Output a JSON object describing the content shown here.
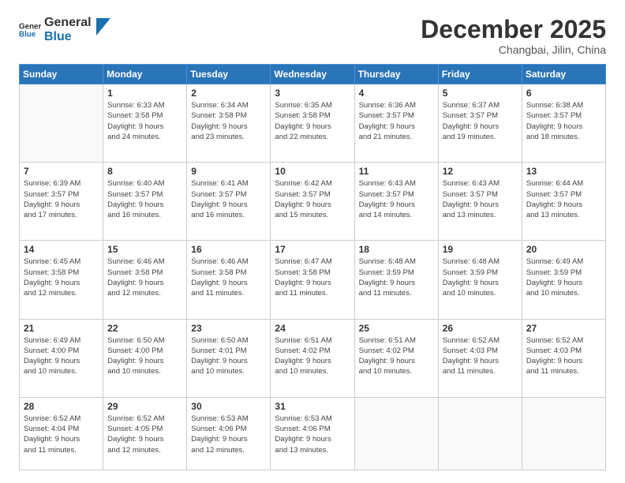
{
  "logo": {
    "text_general": "General",
    "text_blue": "Blue"
  },
  "header": {
    "month_title": "December 2025",
    "location": "Changbai, Jilin, China"
  },
  "days_of_week": [
    "Sunday",
    "Monday",
    "Tuesday",
    "Wednesday",
    "Thursday",
    "Friday",
    "Saturday"
  ],
  "weeks": [
    [
      {
        "day": "",
        "info": ""
      },
      {
        "day": "1",
        "info": "Sunrise: 6:33 AM\nSunset: 3:58 PM\nDaylight: 9 hours\nand 24 minutes."
      },
      {
        "day": "2",
        "info": "Sunrise: 6:34 AM\nSunset: 3:58 PM\nDaylight: 9 hours\nand 23 minutes."
      },
      {
        "day": "3",
        "info": "Sunrise: 6:35 AM\nSunset: 3:58 PM\nDaylight: 9 hours\nand 22 minutes."
      },
      {
        "day": "4",
        "info": "Sunrise: 6:36 AM\nSunset: 3:57 PM\nDaylight: 9 hours\nand 21 minutes."
      },
      {
        "day": "5",
        "info": "Sunrise: 6:37 AM\nSunset: 3:57 PM\nDaylight: 9 hours\nand 19 minutes."
      },
      {
        "day": "6",
        "info": "Sunrise: 6:38 AM\nSunset: 3:57 PM\nDaylight: 9 hours\nand 18 minutes."
      }
    ],
    [
      {
        "day": "7",
        "info": "Sunrise: 6:39 AM\nSunset: 3:57 PM\nDaylight: 9 hours\nand 17 minutes."
      },
      {
        "day": "8",
        "info": "Sunrise: 6:40 AM\nSunset: 3:57 PM\nDaylight: 9 hours\nand 16 minutes."
      },
      {
        "day": "9",
        "info": "Sunrise: 6:41 AM\nSunset: 3:57 PM\nDaylight: 9 hours\nand 16 minutes."
      },
      {
        "day": "10",
        "info": "Sunrise: 6:42 AM\nSunset: 3:57 PM\nDaylight: 9 hours\nand 15 minutes."
      },
      {
        "day": "11",
        "info": "Sunrise: 6:43 AM\nSunset: 3:57 PM\nDaylight: 9 hours\nand 14 minutes."
      },
      {
        "day": "12",
        "info": "Sunrise: 6:43 AM\nSunset: 3:57 PM\nDaylight: 9 hours\nand 13 minutes."
      },
      {
        "day": "13",
        "info": "Sunrise: 6:44 AM\nSunset: 3:57 PM\nDaylight: 9 hours\nand 13 minutes."
      }
    ],
    [
      {
        "day": "14",
        "info": "Sunrise: 6:45 AM\nSunset: 3:58 PM\nDaylight: 9 hours\nand 12 minutes."
      },
      {
        "day": "15",
        "info": "Sunrise: 6:46 AM\nSunset: 3:58 PM\nDaylight: 9 hours\nand 12 minutes."
      },
      {
        "day": "16",
        "info": "Sunrise: 6:46 AM\nSunset: 3:58 PM\nDaylight: 9 hours\nand 11 minutes."
      },
      {
        "day": "17",
        "info": "Sunrise: 6:47 AM\nSunset: 3:58 PM\nDaylight: 9 hours\nand 11 minutes."
      },
      {
        "day": "18",
        "info": "Sunrise: 6:48 AM\nSunset: 3:59 PM\nDaylight: 9 hours\nand 11 minutes."
      },
      {
        "day": "19",
        "info": "Sunrise: 6:48 AM\nSunset: 3:59 PM\nDaylight: 9 hours\nand 10 minutes."
      },
      {
        "day": "20",
        "info": "Sunrise: 6:49 AM\nSunset: 3:59 PM\nDaylight: 9 hours\nand 10 minutes."
      }
    ],
    [
      {
        "day": "21",
        "info": "Sunrise: 6:49 AM\nSunset: 4:00 PM\nDaylight: 9 hours\nand 10 minutes."
      },
      {
        "day": "22",
        "info": "Sunrise: 6:50 AM\nSunset: 4:00 PM\nDaylight: 9 hours\nand 10 minutes."
      },
      {
        "day": "23",
        "info": "Sunrise: 6:50 AM\nSunset: 4:01 PM\nDaylight: 9 hours\nand 10 minutes."
      },
      {
        "day": "24",
        "info": "Sunrise: 6:51 AM\nSunset: 4:02 PM\nDaylight: 9 hours\nand 10 minutes."
      },
      {
        "day": "25",
        "info": "Sunrise: 6:51 AM\nSunset: 4:02 PM\nDaylight: 9 hours\nand 10 minutes."
      },
      {
        "day": "26",
        "info": "Sunrise: 6:52 AM\nSunset: 4:03 PM\nDaylight: 9 hours\nand 11 minutes."
      },
      {
        "day": "27",
        "info": "Sunrise: 6:52 AM\nSunset: 4:03 PM\nDaylight: 9 hours\nand 11 minutes."
      }
    ],
    [
      {
        "day": "28",
        "info": "Sunrise: 6:52 AM\nSunset: 4:04 PM\nDaylight: 9 hours\nand 11 minutes."
      },
      {
        "day": "29",
        "info": "Sunrise: 6:52 AM\nSunset: 4:05 PM\nDaylight: 9 hours\nand 12 minutes."
      },
      {
        "day": "30",
        "info": "Sunrise: 6:53 AM\nSunset: 4:06 PM\nDaylight: 9 hours\nand 12 minutes."
      },
      {
        "day": "31",
        "info": "Sunrise: 6:53 AM\nSunset: 4:06 PM\nDaylight: 9 hours\nand 13 minutes."
      },
      {
        "day": "",
        "info": ""
      },
      {
        "day": "",
        "info": ""
      },
      {
        "day": "",
        "info": ""
      }
    ]
  ]
}
